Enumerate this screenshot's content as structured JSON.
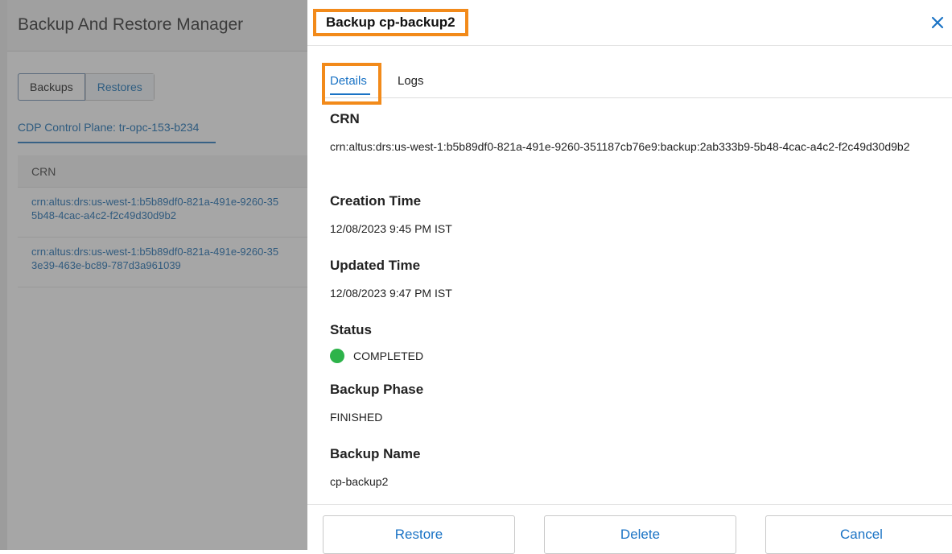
{
  "background": {
    "app_title": "Backup And Restore Manager",
    "segments": [
      "Backups",
      "Restores"
    ],
    "control_plane_label": "CDP Control Plane: tr-opc-153-b234",
    "table": {
      "header": "CRN",
      "rows": [
        {
          "line1": "crn:altus:drs:us-west-1:b5b89df0-821a-491e-9260-35",
          "line2": "5b48-4cac-a4c2-f2c49d30d9b2"
        },
        {
          "line1": "crn:altus:drs:us-west-1:b5b89df0-821a-491e-9260-35",
          "line2": "3e39-463e-bc89-787d3a961039"
        }
      ]
    }
  },
  "drawer": {
    "title": "Backup cp-backup2",
    "close_icon": "close-icon",
    "tabs": {
      "details": "Details",
      "logs": "Logs"
    },
    "fields": {
      "crn_label": "CRN",
      "crn_value": "crn:altus:drs:us-west-1:b5b89df0-821a-491e-9260-351187cb76e9:backup:2ab333b9-5b48-4cac-a4c2-f2c49d30d9b2",
      "creation_time_label": "Creation Time",
      "creation_time_value": "12/08/2023 9:45 PM IST",
      "updated_time_label": "Updated Time",
      "updated_time_value": "12/08/2023 9:47 PM IST",
      "status_label": "Status",
      "status_value": "COMPLETED",
      "status_color": "#2db34a",
      "backup_phase_label": "Backup Phase",
      "backup_phase_value": "FINISHED",
      "backup_name_label": "Backup Name",
      "backup_name_value": "cp-backup2"
    },
    "footer": {
      "restore": "Restore",
      "delete": "Delete",
      "cancel": "Cancel"
    }
  },
  "colors": {
    "accent": "#1a73c5",
    "highlight": "#f28a1a",
    "success": "#2db34a"
  }
}
